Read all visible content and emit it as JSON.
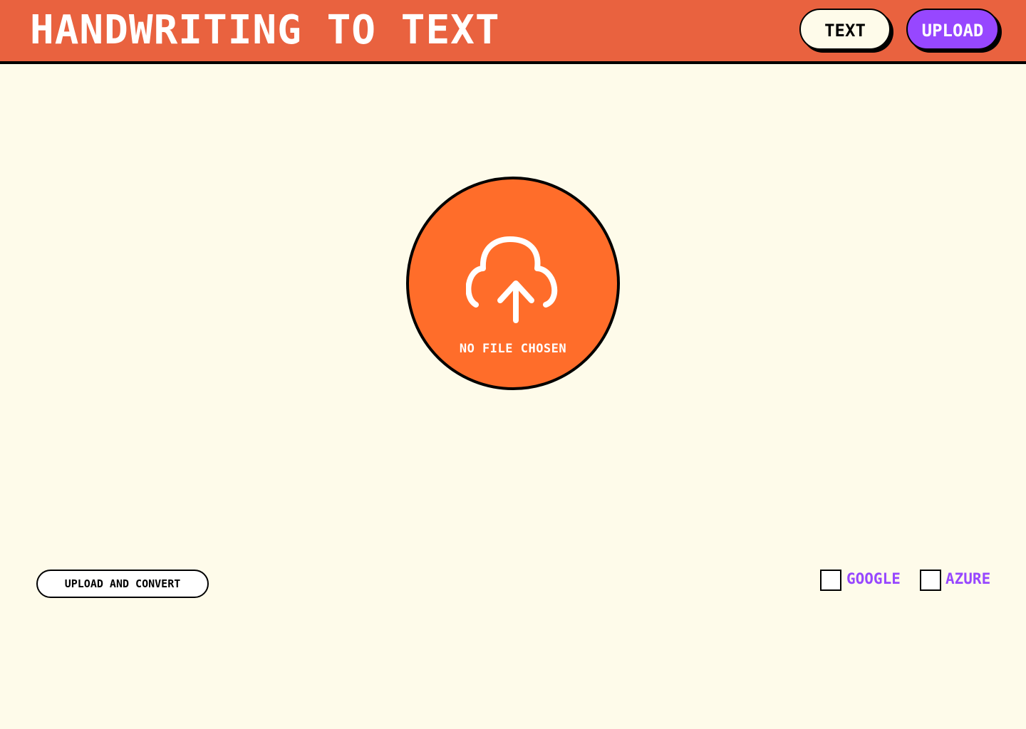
{
  "header": {
    "title": "Handwriting to Text",
    "nav": {
      "text_label": "Text",
      "upload_label": "Upload"
    }
  },
  "upload": {
    "icon": "cloud-upload-icon",
    "status": "No file chosen"
  },
  "actions": {
    "convert_label": "Upload and Convert"
  },
  "providers": [
    {
      "label": "Google",
      "checked": false
    },
    {
      "label": "Azure",
      "checked": false
    }
  ],
  "colors": {
    "header_bg": "#E9623F",
    "page_bg": "#FEFBEA",
    "accent_purple": "#9747FF",
    "upload_orange": "#FF6D2A"
  }
}
